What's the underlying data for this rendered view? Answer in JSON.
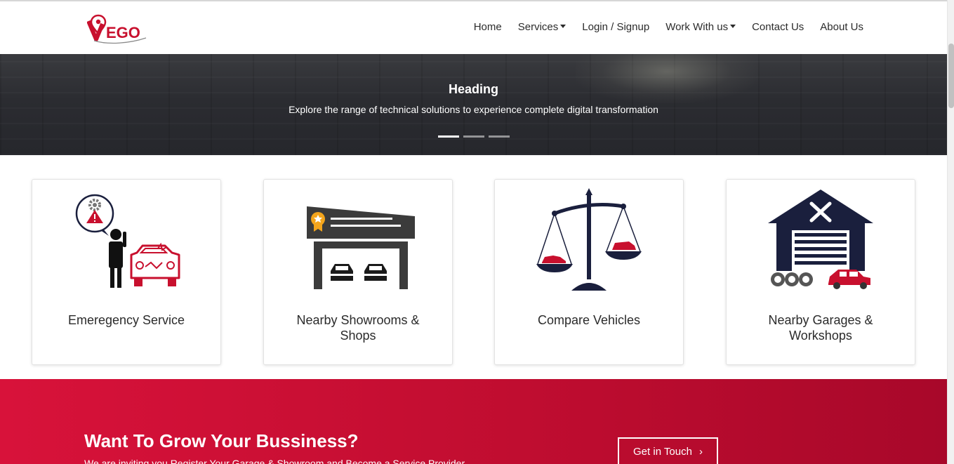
{
  "brand": {
    "logo_text": "EGO"
  },
  "nav": {
    "home": "Home",
    "services": "Services",
    "login": "Login / Signup",
    "work": "Work With us",
    "contact": "Contact Us",
    "about": "About Us"
  },
  "hero": {
    "title": "Heading",
    "subtitle": "Explore the range of technical solutions to experience complete digital transformation",
    "slides": 3,
    "active_slide": 1
  },
  "cards": [
    {
      "title": "Emeregency Service",
      "icon": "emergency-service-icon"
    },
    {
      "title": "Nearby Showrooms & Shops",
      "icon": "showroom-icon"
    },
    {
      "title": "Compare Vehicles",
      "icon": "scale-compare-icon"
    },
    {
      "title": "Nearby Garages & Workshops",
      "icon": "garage-icon"
    }
  ],
  "cta": {
    "title": "Want To Grow Your Bussiness?",
    "subtitle": "We are inviting you Register Your Garage & Showroom and Become a Service Provider",
    "button": "Get in Touch",
    "button_icon": "chevron-right-icon"
  },
  "colors": {
    "brand_red": "#c8102e",
    "navy": "#1a1f3d",
    "cta_red": "#d8123a"
  }
}
